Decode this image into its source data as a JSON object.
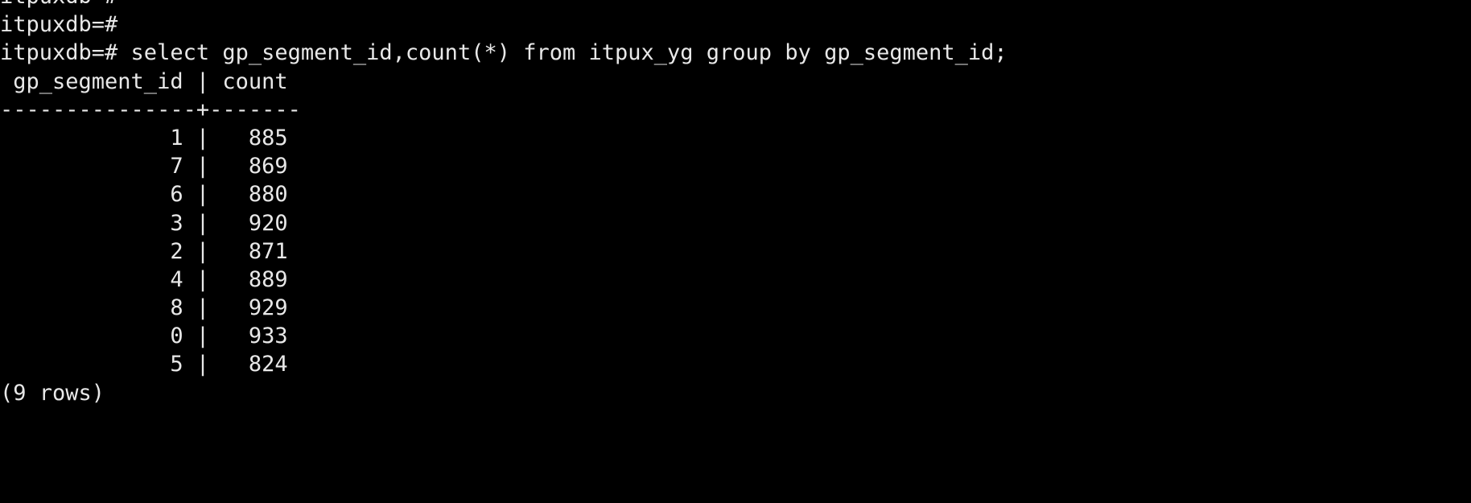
{
  "terminal": {
    "background_color": "#000000",
    "foreground_color": "#e8e8e8",
    "prompt": "itpuxdb=#",
    "lines": {
      "clipped_prompt": "itpuxdb=#",
      "empty_prompt": "itpuxdb=#",
      "command": "itpuxdb=# select gp_segment_id,count(*) from itpux_yg group by gp_segment_id;",
      "header": " gp_segment_id | count",
      "separator": "---------------+-------",
      "row_1": "             1 |   885",
      "row_2": "             7 |   869",
      "row_3": "             6 |   880",
      "row_4": "             3 |   920",
      "row_5": "             2 |   871",
      "row_6": "             4 |   889",
      "row_7": "             8 |   929",
      "row_8": "             0 |   933",
      "row_9": "             5 |   824",
      "footer": "(9 rows)"
    },
    "query": {
      "statement": "select gp_segment_id,count(*) from itpux_yg group by gp_segment_id;",
      "table": "itpux_yg",
      "group_by": "gp_segment_id",
      "aggregate": "count(*)"
    },
    "result": {
      "columns": [
        "gp_segment_id",
        "count"
      ],
      "rows": [
        {
          "gp_segment_id": "1",
          "count": "885"
        },
        {
          "gp_segment_id": "7",
          "count": "869"
        },
        {
          "gp_segment_id": "6",
          "count": "880"
        },
        {
          "gp_segment_id": "3",
          "count": "920"
        },
        {
          "gp_segment_id": "2",
          "count": "871"
        },
        {
          "gp_segment_id": "4",
          "count": "889"
        },
        {
          "gp_segment_id": "8",
          "count": "929"
        },
        {
          "gp_segment_id": "0",
          "count": "933"
        },
        {
          "gp_segment_id": "5",
          "count": "824"
        }
      ],
      "row_count_label": "(9 rows)"
    }
  }
}
